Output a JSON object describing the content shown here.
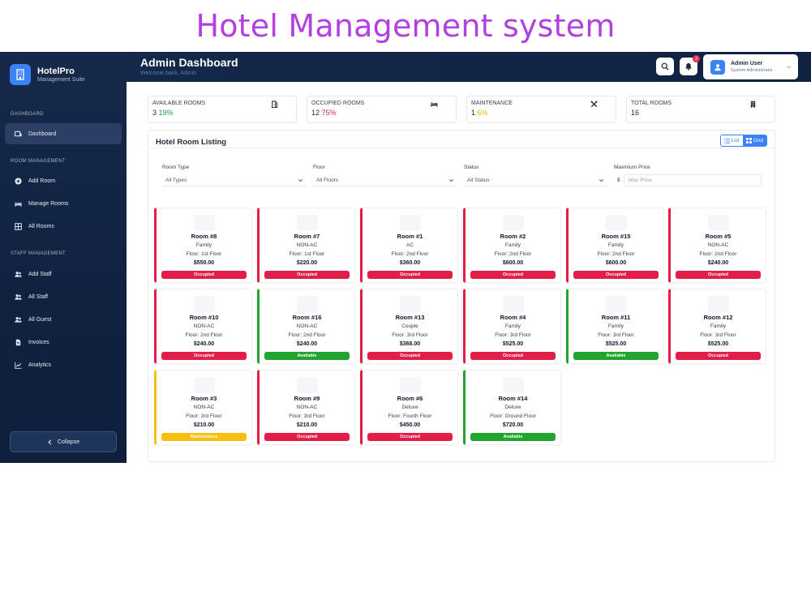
{
  "banner": {
    "title": "Hotel Management system"
  },
  "brand": {
    "name": "HotelPro",
    "subtitle": "Management Suite"
  },
  "sidebar": {
    "sections": [
      {
        "label": "DASHBOARD"
      },
      {
        "label": "ROOM MANAGEMENT"
      },
      {
        "label": "STAFF MANAGEMENT"
      }
    ],
    "items": [
      {
        "label": "Dashboard",
        "icon": "dashboard-icon"
      },
      {
        "label": "Add Room",
        "icon": "plus-circle-icon"
      },
      {
        "label": "Manage Rooms",
        "icon": "bed-icon"
      },
      {
        "label": "All Rooms",
        "icon": "grid-icon"
      },
      {
        "label": "Add Staff",
        "icon": "users-icon"
      },
      {
        "label": "All Staff",
        "icon": "users-icon"
      },
      {
        "label": "All Guest",
        "icon": "users-icon"
      },
      {
        "label": "Invoices",
        "icon": "file-icon"
      },
      {
        "label": "Analytics",
        "icon": "chart-line-icon"
      }
    ],
    "collapse_label": "Collapse"
  },
  "header": {
    "title": "Admin Dashboard",
    "subtitle": "Welcome back, Admin",
    "notification_count": "3",
    "user": {
      "name": "Admin User",
      "role": "System Administrator"
    }
  },
  "stats": [
    {
      "label": "AVAILABLE ROOMS",
      "value": "3",
      "percent": "19%",
      "icon": "door-icon"
    },
    {
      "label": "OCCUPIED ROOMS",
      "value": "12",
      "percent": "75%",
      "icon": "bed-icon"
    },
    {
      "label": "MAINTENANCE",
      "value": "1",
      "percent": "6%",
      "icon": "tools-icon"
    },
    {
      "label": "TOTAL ROOMS",
      "value": "16",
      "percent": "",
      "icon": "building-icon"
    }
  ],
  "listing": {
    "title": "Hotel Room Listing",
    "view_list": "List",
    "view_grid": "Grid",
    "filters": {
      "room_type": {
        "label": "Room Type",
        "value": "All Types"
      },
      "floor": {
        "label": "Floor",
        "value": "All Floors"
      },
      "status": {
        "label": "Status",
        "value": "All Status"
      },
      "price": {
        "label": "Maximum Price",
        "prefix": "$",
        "placeholder": "Max Price"
      }
    }
  },
  "rooms": [
    {
      "name": "Room #8",
      "type": "Family",
      "floor": "Floor: 1st Floor",
      "price": "$550.00",
      "status": "Occupied"
    },
    {
      "name": "Room #7",
      "type": "NON-AC",
      "floor": "Floor: 1st Floor",
      "price": "$220.00",
      "status": "Occupied"
    },
    {
      "name": "Room #1",
      "type": "AC",
      "floor": "Floor: 2nd Floor",
      "price": "$360.00",
      "status": "Occupied"
    },
    {
      "name": "Room #2",
      "type": "Family",
      "floor": "Floor: 2nd Floor",
      "price": "$600.00",
      "status": "Occupied"
    },
    {
      "name": "Room #15",
      "type": "Family",
      "floor": "Floor: 2nd Floor",
      "price": "$600.00",
      "status": "Occupied"
    },
    {
      "name": "Room #5",
      "type": "NON-AC",
      "floor": "Floor: 2nd Floor",
      "price": "$240.00",
      "status": "Occupied"
    },
    {
      "name": "Room #10",
      "type": "NON-AC",
      "floor": "Floor: 2nd Floor",
      "price": "$240.00",
      "status": "Occupied"
    },
    {
      "name": "Room #16",
      "type": "NON-AC",
      "floor": "Floor: 2nd Floor",
      "price": "$240.00",
      "status": "Available"
    },
    {
      "name": "Room #13",
      "type": "Couple",
      "floor": "Floor: 3rd Floor",
      "price": "$368.00",
      "status": "Occupied"
    },
    {
      "name": "Room #4",
      "type": "Family",
      "floor": "Floor: 3rd Floor",
      "price": "$525.00",
      "status": "Occupied"
    },
    {
      "name": "Room #11",
      "type": "Family",
      "floor": "Floor: 3rd Floor",
      "price": "$525.00",
      "status": "Available"
    },
    {
      "name": "Room #12",
      "type": "Family",
      "floor": "Floor: 3rd Floor",
      "price": "$525.00",
      "status": "Occupied"
    },
    {
      "name": "Room #3",
      "type": "NON-AC",
      "floor": "Floor: 3rd Floor",
      "price": "$210.00",
      "status": "Maintenance"
    },
    {
      "name": "Room #9",
      "type": "NON-AC",
      "floor": "Floor: 3rd Floor",
      "price": "$210.00",
      "status": "Occupied"
    },
    {
      "name": "Room #6",
      "type": "Deluxe",
      "floor": "Floor: Fourth Floor",
      "price": "$450.00",
      "status": "Occupied"
    },
    {
      "name": "Room #14",
      "type": "Deluxe",
      "floor": "Floor: Ground Floor",
      "price": "$720.00",
      "status": "Available"
    }
  ],
  "colors": {
    "occupied": "#e11d48",
    "available": "#22a52e",
    "maintenance": "#f6bf12",
    "accent": "#3b82f6",
    "banner_title": "#b43fe0"
  }
}
